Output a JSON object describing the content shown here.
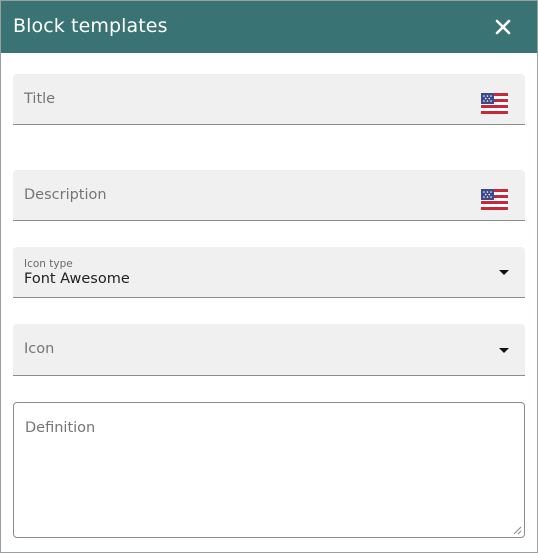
{
  "dialog": {
    "title": "Block templates",
    "close_icon": "close-icon"
  },
  "form": {
    "title_field": {
      "placeholder": "Title",
      "language_icon": "us-flag-icon"
    },
    "description_field": {
      "placeholder": "Description",
      "language_icon": "us-flag-icon"
    },
    "icon_type_field": {
      "label": "Icon type",
      "value": "Font Awesome",
      "dropdown_icon": "caret-down-icon"
    },
    "icon_field": {
      "placeholder": "Icon",
      "dropdown_icon": "caret-down-icon"
    },
    "definition_field": {
      "placeholder": "Definition"
    }
  },
  "colors": {
    "header_bg": "#3a7373",
    "field_bg": "#f0f0f0"
  }
}
